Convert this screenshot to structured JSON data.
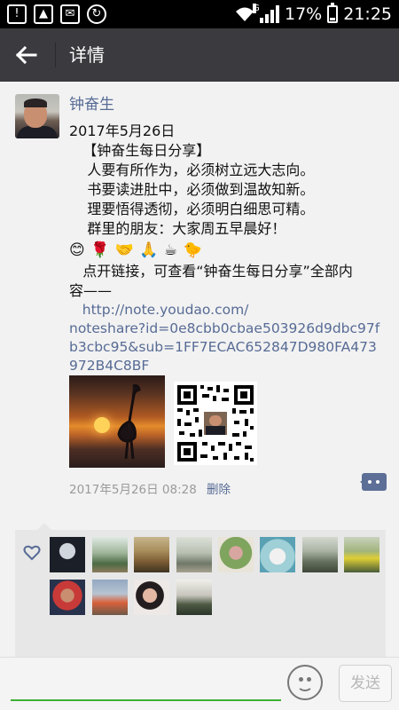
{
  "status_bar": {
    "left_icons": [
      "warning-icon",
      "image-icon",
      "mail-icon",
      "sync-icon"
    ],
    "network": "G",
    "battery": "17%",
    "time": "21:25"
  },
  "title_bar": {
    "title": "详情"
  },
  "post": {
    "author": "钟奋生",
    "lines": [
      "2017年5月26日",
      "   【钟奋生每日分享】",
      "    人要有所作为，必须树立远大志向。",
      "    书要读进肚中，必须做到温故知新。",
      "    理要悟得透彻，必须明白细思可精。",
      "    群里的朋友：大家周五早晨好！"
    ],
    "emojis": [
      "😊",
      "🌹",
      "🤝",
      "🙏",
      "☕",
      "🐤"
    ],
    "link_intro_lines": [
      "   点开链接，可查看“钟奋生每日分享”全部内",
      "容——"
    ],
    "link_lines": [
      "   http://note.youdao.com/",
      "noteshare?id=0e8cbb0cbae503926d9dbc97f",
      "b3cbc95&sub=1FF7ECAC652847D980FA473",
      "972B4C8BF"
    ],
    "timestamp": "2017年5月26日 08:28",
    "delete_label": "删除"
  },
  "likes": {
    "count": 13
  },
  "bottom_bar": {
    "send_label": "发送"
  },
  "colors": {
    "status_bar": "#000000",
    "title_bar": "#3a3a3f",
    "link": "#576b95",
    "input_underline": "#3cb034"
  }
}
